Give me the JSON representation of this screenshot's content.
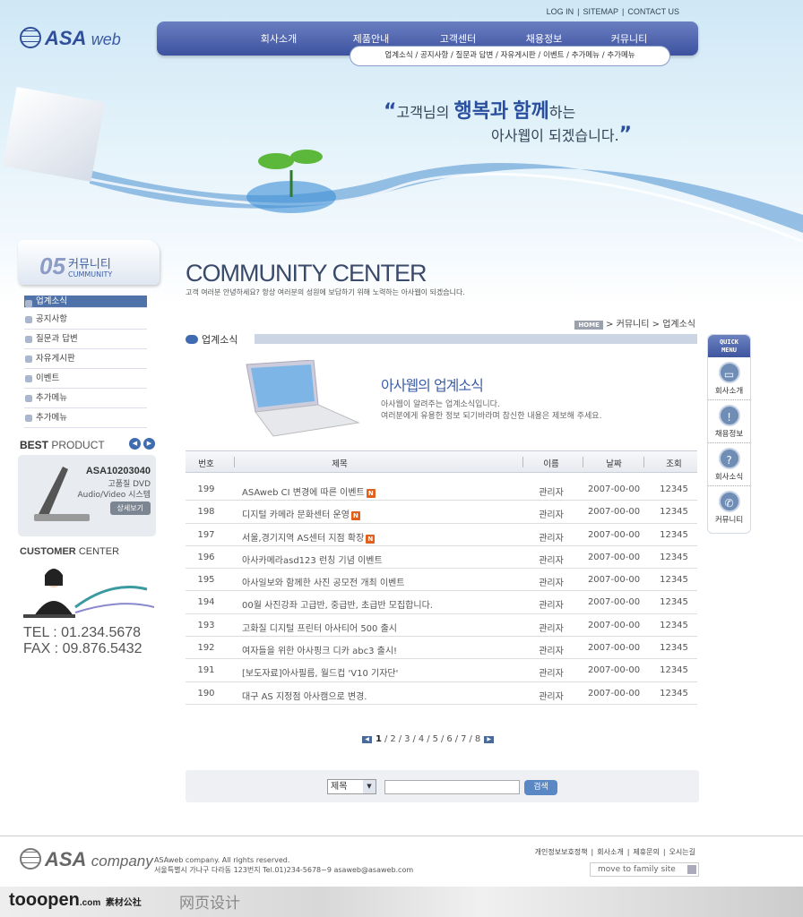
{
  "brand": {
    "logo_main": "ASA",
    "logo_sub": "web"
  },
  "top_links": [
    "LOG IN",
    "SITEMAP",
    "CONTACT US"
  ],
  "nav": [
    "회사소개",
    "제품안내",
    "고객센터",
    "채용정보",
    "커뮤니티"
  ],
  "subnav": [
    "업계소식",
    "공지사항",
    "질문과 답변",
    "자유게시판",
    "이벤트",
    "추가메뉴",
    "추가메뉴"
  ],
  "slogan": {
    "pre": "고객님의",
    "b1": "행복과",
    "b2": "함께",
    "post": "하는",
    "line2": "아사웹이 되겠습니다."
  },
  "sidebar": {
    "num": "05",
    "title": "커뮤니티",
    "title_en": "CUMMUNITY",
    "items": [
      "업계소식",
      "공지사항",
      "질문과 답변",
      "자유게시판",
      "이벤트",
      "추가메뉴",
      "추가메뉴"
    ],
    "best_bold": "BEST",
    "best_rest": "PRODUCT",
    "product": {
      "model": "ASA10203040",
      "desc1": "고품질 DVD",
      "desc2": "Audio/Video 시스템",
      "button": "상세보기"
    },
    "cc_bold": "CUSTOMER",
    "cc_rest": "CENTER",
    "tel": "TEL : 01.234.5678",
    "fax": "FAX : 09.876.5432"
  },
  "main": {
    "title": "COMMUNITY CENTER",
    "subtitle": "고객 여러분 안녕하세요? 항상 여러분의 성원에 보답하기 위해  노력하는 아사웹이 되겠습니다.",
    "breadcrumb": {
      "home": "HOME",
      "items": [
        "커뮤니티",
        "업계소식"
      ]
    },
    "section": "업계소식",
    "intro_title": "아사웹의 업계소식",
    "intro_1": "아사웹이 알려주는 업계소식입니다.",
    "intro_2": "여러분에게 유용한 정보 되기바라며 참신한 내용은 제보해 주세요."
  },
  "table": {
    "headers": [
      "번호",
      "제목",
      "이름",
      "날짜",
      "조회"
    ],
    "rows": [
      {
        "no": "199",
        "title": "ASAweb CI 변경에 따른 이벤트",
        "new": true,
        "name": "관리자",
        "date": "2007-00-00",
        "views": "12345"
      },
      {
        "no": "198",
        "title": "디지털 카메라 문화센터 운영",
        "new": true,
        "name": "관리자",
        "date": "2007-00-00",
        "views": "12345"
      },
      {
        "no": "197",
        "title": "서울,경기지역 AS센터 지점 확장",
        "new": true,
        "name": "관리자",
        "date": "2007-00-00",
        "views": "12345"
      },
      {
        "no": "196",
        "title": "아사카메라asd123 런칭 기념 이벤트",
        "new": false,
        "name": "관리자",
        "date": "2007-00-00",
        "views": "12345"
      },
      {
        "no": "195",
        "title": "아사일보와 함께한 사진 공모전 개최 이벤트",
        "new": false,
        "name": "관리자",
        "date": "2007-00-00",
        "views": "12345"
      },
      {
        "no": "194",
        "title": "00월 사진강좌 고급반, 중급반, 초급반 모집합니다.",
        "new": false,
        "name": "관리자",
        "date": "2007-00-00",
        "views": "12345"
      },
      {
        "no": "193",
        "title": "고화질 디지털 프린터 아사티어 500 출시",
        "new": false,
        "name": "관리자",
        "date": "2007-00-00",
        "views": "12345"
      },
      {
        "no": "192",
        "title": "여자들을 위한 아사핑크 디카 abc3 출시!",
        "new": false,
        "name": "관리자",
        "date": "2007-00-00",
        "views": "12345"
      },
      {
        "no": "191",
        "title": "[보도자료]아사필름, 월드컵 'V10 기자단'",
        "new": false,
        "name": "관리자",
        "date": "2007-00-00",
        "views": "12345"
      },
      {
        "no": "190",
        "title": "대구 AS 지정점 아사캠으로 변경.",
        "new": false,
        "name": "관리자",
        "date": "2007-00-00",
        "views": "12345"
      }
    ],
    "new_badge": "N"
  },
  "pagination": {
    "pages": [
      "1",
      "2",
      "3",
      "4",
      "5",
      "6",
      "7",
      "8"
    ],
    "current": "1"
  },
  "search": {
    "field": "제목",
    "button": "검색",
    "value": ""
  },
  "quick": {
    "title1": "QUICK",
    "title2": "MENU",
    "items": [
      "회사소개",
      "채용정보",
      "회사소식",
      "커뮤니티"
    ]
  },
  "footer": {
    "logo_main": "ASA",
    "logo_sub": "company",
    "copy1": "ASAweb company. All rights reserved.",
    "copy2": "서울특별시 가나구 다라동 123번지 Tel.01)234-5678~9 asaweb@asaweb.com",
    "links": [
      "개인정보보호정책",
      "회사소개",
      "제휴문의",
      "오시는길"
    ],
    "family": "move to family site"
  },
  "watermark": {
    "brand": "tooopen",
    "dom": ".com",
    "cn": "素材公社",
    "cat": "网页设计"
  },
  "colors": {
    "nav": "#3d52a0",
    "accent": "#4f72a8",
    "new": "#e0601d"
  }
}
